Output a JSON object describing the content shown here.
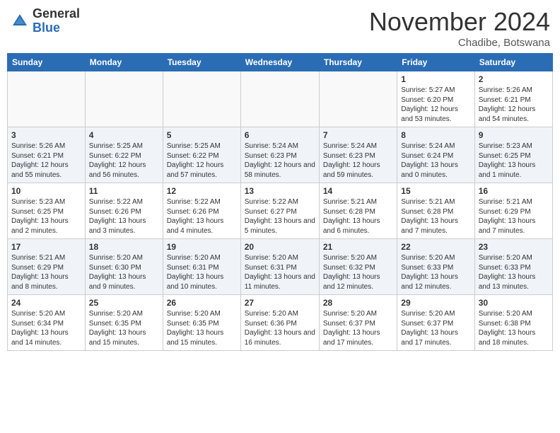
{
  "logo": {
    "general": "General",
    "blue": "Blue"
  },
  "title": "November 2024",
  "location": "Chadibe, Botswana",
  "days_of_week": [
    "Sunday",
    "Monday",
    "Tuesday",
    "Wednesday",
    "Thursday",
    "Friday",
    "Saturday"
  ],
  "weeks": [
    {
      "shade": false,
      "days": [
        {
          "num": "",
          "info": ""
        },
        {
          "num": "",
          "info": ""
        },
        {
          "num": "",
          "info": ""
        },
        {
          "num": "",
          "info": ""
        },
        {
          "num": "",
          "info": ""
        },
        {
          "num": "1",
          "info": "Sunrise: 5:27 AM\nSunset: 6:20 PM\nDaylight: 12 hours and 53 minutes."
        },
        {
          "num": "2",
          "info": "Sunrise: 5:26 AM\nSunset: 6:21 PM\nDaylight: 12 hours and 54 minutes."
        }
      ]
    },
    {
      "shade": true,
      "days": [
        {
          "num": "3",
          "info": "Sunrise: 5:26 AM\nSunset: 6:21 PM\nDaylight: 12 hours and 55 minutes."
        },
        {
          "num": "4",
          "info": "Sunrise: 5:25 AM\nSunset: 6:22 PM\nDaylight: 12 hours and 56 minutes."
        },
        {
          "num": "5",
          "info": "Sunrise: 5:25 AM\nSunset: 6:22 PM\nDaylight: 12 hours and 57 minutes."
        },
        {
          "num": "6",
          "info": "Sunrise: 5:24 AM\nSunset: 6:23 PM\nDaylight: 12 hours and 58 minutes."
        },
        {
          "num": "7",
          "info": "Sunrise: 5:24 AM\nSunset: 6:23 PM\nDaylight: 12 hours and 59 minutes."
        },
        {
          "num": "8",
          "info": "Sunrise: 5:24 AM\nSunset: 6:24 PM\nDaylight: 13 hours and 0 minutes."
        },
        {
          "num": "9",
          "info": "Sunrise: 5:23 AM\nSunset: 6:25 PM\nDaylight: 13 hours and 1 minute."
        }
      ]
    },
    {
      "shade": false,
      "days": [
        {
          "num": "10",
          "info": "Sunrise: 5:23 AM\nSunset: 6:25 PM\nDaylight: 13 hours and 2 minutes."
        },
        {
          "num": "11",
          "info": "Sunrise: 5:22 AM\nSunset: 6:26 PM\nDaylight: 13 hours and 3 minutes."
        },
        {
          "num": "12",
          "info": "Sunrise: 5:22 AM\nSunset: 6:26 PM\nDaylight: 13 hours and 4 minutes."
        },
        {
          "num": "13",
          "info": "Sunrise: 5:22 AM\nSunset: 6:27 PM\nDaylight: 13 hours and 5 minutes."
        },
        {
          "num": "14",
          "info": "Sunrise: 5:21 AM\nSunset: 6:28 PM\nDaylight: 13 hours and 6 minutes."
        },
        {
          "num": "15",
          "info": "Sunrise: 5:21 AM\nSunset: 6:28 PM\nDaylight: 13 hours and 7 minutes."
        },
        {
          "num": "16",
          "info": "Sunrise: 5:21 AM\nSunset: 6:29 PM\nDaylight: 13 hours and 7 minutes."
        }
      ]
    },
    {
      "shade": true,
      "days": [
        {
          "num": "17",
          "info": "Sunrise: 5:21 AM\nSunset: 6:29 PM\nDaylight: 13 hours and 8 minutes."
        },
        {
          "num": "18",
          "info": "Sunrise: 5:20 AM\nSunset: 6:30 PM\nDaylight: 13 hours and 9 minutes."
        },
        {
          "num": "19",
          "info": "Sunrise: 5:20 AM\nSunset: 6:31 PM\nDaylight: 13 hours and 10 minutes."
        },
        {
          "num": "20",
          "info": "Sunrise: 5:20 AM\nSunset: 6:31 PM\nDaylight: 13 hours and 11 minutes."
        },
        {
          "num": "21",
          "info": "Sunrise: 5:20 AM\nSunset: 6:32 PM\nDaylight: 13 hours and 12 minutes."
        },
        {
          "num": "22",
          "info": "Sunrise: 5:20 AM\nSunset: 6:33 PM\nDaylight: 13 hours and 12 minutes."
        },
        {
          "num": "23",
          "info": "Sunrise: 5:20 AM\nSunset: 6:33 PM\nDaylight: 13 hours and 13 minutes."
        }
      ]
    },
    {
      "shade": false,
      "days": [
        {
          "num": "24",
          "info": "Sunrise: 5:20 AM\nSunset: 6:34 PM\nDaylight: 13 hours and 14 minutes."
        },
        {
          "num": "25",
          "info": "Sunrise: 5:20 AM\nSunset: 6:35 PM\nDaylight: 13 hours and 15 minutes."
        },
        {
          "num": "26",
          "info": "Sunrise: 5:20 AM\nSunset: 6:35 PM\nDaylight: 13 hours and 15 minutes."
        },
        {
          "num": "27",
          "info": "Sunrise: 5:20 AM\nSunset: 6:36 PM\nDaylight: 13 hours and 16 minutes."
        },
        {
          "num": "28",
          "info": "Sunrise: 5:20 AM\nSunset: 6:37 PM\nDaylight: 13 hours and 17 minutes."
        },
        {
          "num": "29",
          "info": "Sunrise: 5:20 AM\nSunset: 6:37 PM\nDaylight: 13 hours and 17 minutes."
        },
        {
          "num": "30",
          "info": "Sunrise: 5:20 AM\nSunset: 6:38 PM\nDaylight: 13 hours and 18 minutes."
        }
      ]
    }
  ]
}
